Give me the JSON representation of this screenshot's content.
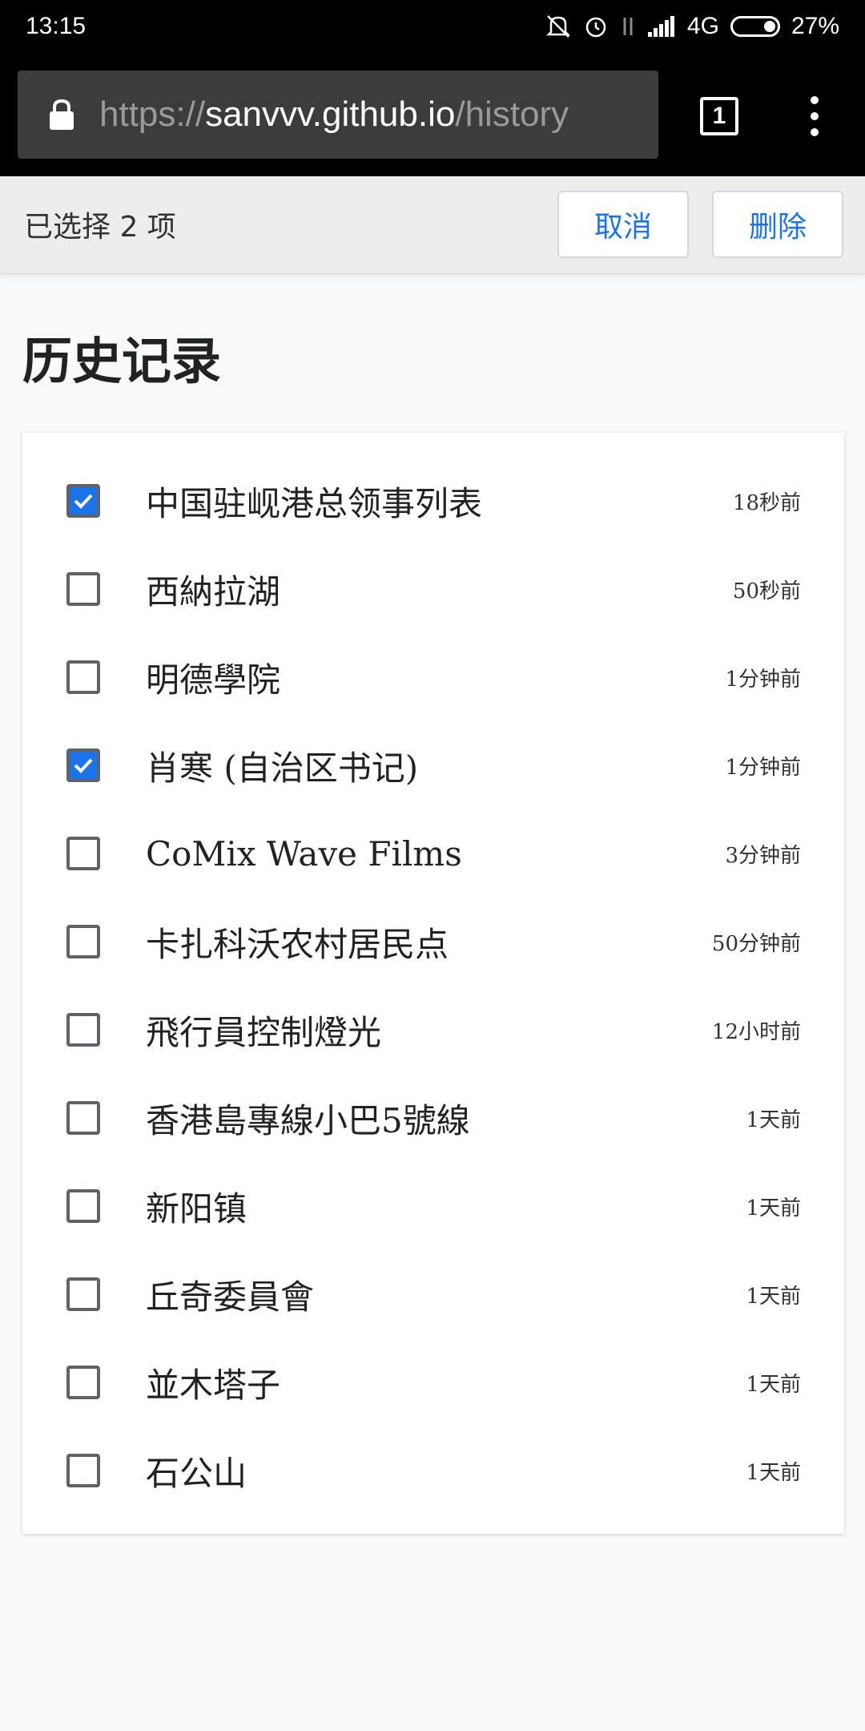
{
  "status_bar": {
    "time": "13:15",
    "network": "4G",
    "battery": "27%",
    "icons": [
      "mute-icon",
      "alarm-icon",
      "data-arrows-icon",
      "signal-icon",
      "battery-icon"
    ]
  },
  "browser": {
    "url_scheme": "https://",
    "url_host": "sanvvv.github.io",
    "url_path": "/history",
    "tab_count": "1"
  },
  "selection_toolbar": {
    "count_label": "已选择 2 项",
    "cancel_label": "取消",
    "delete_label": "删除"
  },
  "page": {
    "title": "历史记录"
  },
  "history": [
    {
      "title": "中国驻岘港总领事列表",
      "time": "18秒前",
      "checked": true
    },
    {
      "title": "西納拉湖",
      "time": "50秒前",
      "checked": false
    },
    {
      "title": "明德學院",
      "time": "1分钟前",
      "checked": false
    },
    {
      "title": "肖寒 (自治区书记)",
      "time": "1分钟前",
      "checked": true
    },
    {
      "title": "CoMix Wave Films",
      "time": "3分钟前",
      "checked": false
    },
    {
      "title": "卡扎科沃农村居民点",
      "time": "50分钟前",
      "checked": false
    },
    {
      "title": "飛行員控制燈光",
      "time": "12小时前",
      "checked": false
    },
    {
      "title": "香港島專線小巴5號線",
      "time": "1天前",
      "checked": false
    },
    {
      "title": "新阳镇",
      "time": "1天前",
      "checked": false
    },
    {
      "title": "丘奇委員會",
      "time": "1天前",
      "checked": false
    },
    {
      "title": "並木塔子",
      "time": "1天前",
      "checked": false
    },
    {
      "title": "石公山",
      "time": "1天前",
      "checked": false
    }
  ],
  "colors": {
    "accent": "#1a73e8",
    "checkbox_border": "#5f6368",
    "background": "#f8f9fa"
  }
}
